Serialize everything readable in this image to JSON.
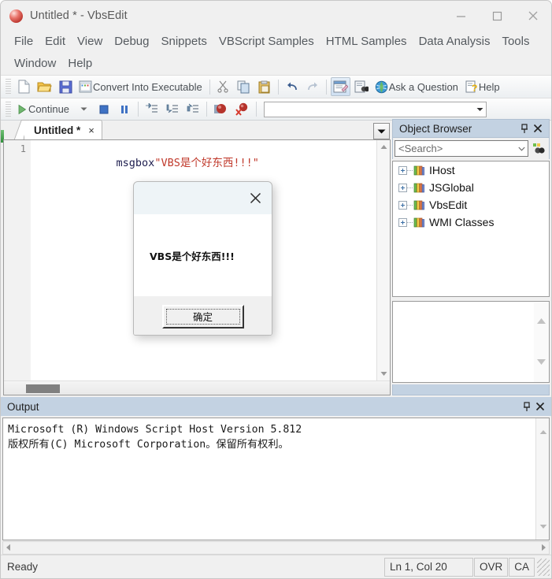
{
  "window": {
    "title": "Untitled * - VbsEdit",
    "app_icon": "red-sphere-icon",
    "minimize": "minimize-icon",
    "maximize": "maximize-icon",
    "close": "close-icon"
  },
  "menubar": {
    "items": [
      {
        "label": "File"
      },
      {
        "label": "Edit"
      },
      {
        "label": "View"
      },
      {
        "label": "Debug"
      },
      {
        "label": "Snippets"
      },
      {
        "label": "VBScript Samples"
      },
      {
        "label": "HTML Samples"
      },
      {
        "label": "Data Analysis"
      },
      {
        "label": "Tools"
      },
      {
        "label": "Window"
      },
      {
        "label": "Help"
      }
    ]
  },
  "toolbar_main": {
    "new_label": "new-file-icon",
    "open_label": "open-folder-icon",
    "save_label": "save-floppy-icon",
    "convert_label": "Convert Into Executable",
    "cut_label": "cut-scissors-icon",
    "copy_label": "copy-icon",
    "paste_label": "paste-clipboard-icon",
    "undo_label": "undo-arrow-icon",
    "redo_label": "redo-arrow-icon",
    "properties_label": "script-properties-icon",
    "find_label": "find-binoculars-icon",
    "ask_label": "Ask a Question",
    "help_label": "Help"
  },
  "toolbar_debug": {
    "continue_label": "Continue",
    "continue_icon": "play-triangle-icon",
    "continue_dropdown": "chevron-down-icon",
    "stop_icon": "stop-square-icon",
    "pause_icon": "pause-bars-icon",
    "step_into_icon": "step-into-icon",
    "step_over_icon": "step-over-icon",
    "step_out_icon": "step-out-icon",
    "breakpoint_icon": "breakpoint-icon",
    "clear_breakpoints_icon": "clear-breakpoints-icon",
    "watch_value": "",
    "watch_dropdown": "chevron-down-icon"
  },
  "editor": {
    "tab": {
      "label": "Untitled *",
      "close": "×"
    },
    "tab_dropdown": "tab-list-dropdown-icon",
    "line_numbers": [
      "1"
    ],
    "code": {
      "keyword": "msgbox",
      "string": "\"VBS是个好东西!!!\"",
      "keyword_color": "#1d1d4e",
      "string_color": "#c0392b"
    },
    "scroll_up": "scroll-up-arrow-icon",
    "scroll_down": "scroll-down-arrow-icon"
  },
  "object_browser": {
    "title": "Object Browser",
    "pin": "pin-icon",
    "close": "close-icon",
    "search_placeholder": "<Search>",
    "search_dropdown": "chevron-down-icon",
    "find_button": "search-objects-icon",
    "tree": [
      {
        "label": "IHost",
        "icon": "books-library-icon",
        "expander": "plus-expander-icon"
      },
      {
        "label": "JSGlobal",
        "icon": "books-library-icon",
        "expander": "plus-expander-icon"
      },
      {
        "label": "VbsEdit",
        "icon": "books-library-icon",
        "expander": "plus-expander-icon"
      },
      {
        "label": "WMI Classes",
        "icon": "books-library-icon",
        "expander": "plus-expander-icon"
      }
    ],
    "detail_scroll_up": "scroll-up-arrow-icon",
    "detail_scroll_down": "scroll-down-arrow-icon"
  },
  "output": {
    "title": "Output",
    "pin": "pin-icon",
    "close": "close-icon",
    "lines": [
      "Microsoft (R) Windows Script Host Version 5.812",
      "版权所有(C) Microsoft Corporation。保留所有权利。"
    ],
    "text": "Microsoft (R) Windows Script Host Version 5.812\n版权所有(C) Microsoft Corporation。保留所有权利。",
    "scroll_up": "scroll-up-arrow-icon",
    "scroll_down": "scroll-down-arrow-icon",
    "scroll_left": "scroll-left-arrow-icon",
    "scroll_right": "scroll-right-arrow-icon"
  },
  "statusbar": {
    "status": "Ready",
    "position": "Ln 1, Col 20",
    "overwrite": "OVR",
    "caps": "CA"
  },
  "dialog": {
    "close": "close-icon",
    "message": "VBS是个好东西!!!",
    "ok_label": "确定",
    "titlebar_color": "#eef4f7"
  }
}
